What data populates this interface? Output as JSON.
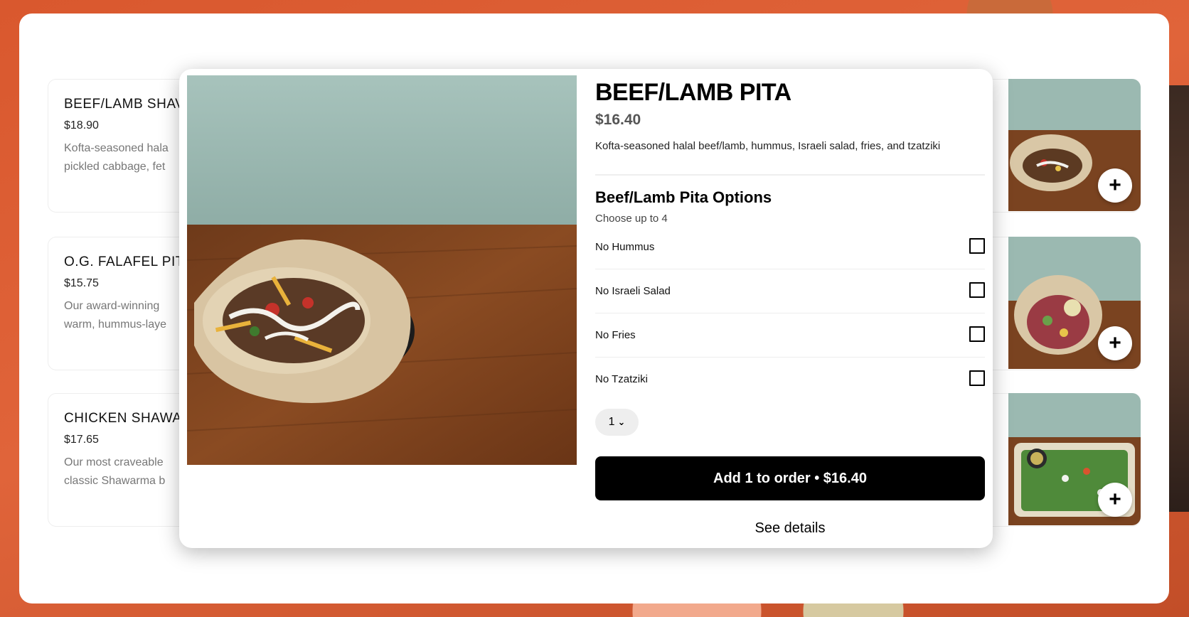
{
  "menu": {
    "items": [
      {
        "name": "BEEF/LAMB SHAV",
        "price": "$18.90",
        "desc_line1": "Kofta-seasoned hala",
        "desc_line2": "pickled cabbage, fet"
      },
      {
        "name": "O.G. FALAFEL PIT",
        "price": "$15.75",
        "desc_line1": "Our award-winning",
        "desc_line2": "warm, hummus-laye"
      },
      {
        "name": "CHICKEN SHAWA",
        "price": "$17.65",
        "desc_line1": "Our most craveable",
        "desc_line2": "classic Shawarma b"
      }
    ],
    "add_label": "+"
  },
  "modal": {
    "title": "BEEF/LAMB PITA",
    "price": "$16.40",
    "description": "Kofta-seasoned halal beef/lamb, hummus, Israeli salad, fries, and tzatziki",
    "options_title": "Beef/Lamb Pita Options",
    "options_subtitle": "Choose up to 4",
    "options": [
      {
        "label": "No Hummus",
        "checked": false
      },
      {
        "label": "No Israeli Salad",
        "checked": false
      },
      {
        "label": "No Fries",
        "checked": false
      },
      {
        "label": "No Tzatziki",
        "checked": false
      }
    ],
    "quantity": "1",
    "add_button": "Add 1 to order • $16.40",
    "see_details": "See details"
  },
  "icons": {
    "quantity": "chevron-down-icon",
    "add": "plus-icon",
    "option": "checkbox-icon"
  },
  "colors": {
    "background_accent": "#d9582e",
    "button": "#000000",
    "wall": "#9fbcb5",
    "table": "#7a4320"
  }
}
